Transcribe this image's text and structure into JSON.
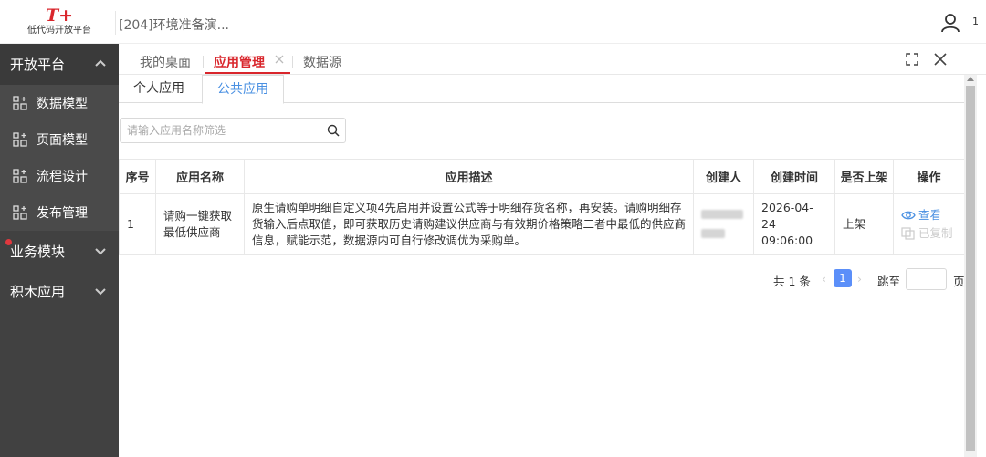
{
  "header": {
    "logo_mark": "T+",
    "logo_text": "低代码开放平台",
    "title": "[204]环境准备演...",
    "user_count": "1"
  },
  "sidebar": {
    "open_group": "开放平台",
    "items": [
      {
        "label": "数据模型"
      },
      {
        "label": "页面模型"
      },
      {
        "label": "流程设计"
      },
      {
        "label": "发布管理"
      }
    ],
    "business_group": "业务模块",
    "blocks_group": "积木应用"
  },
  "tabs": [
    {
      "label": "我的桌面"
    },
    {
      "label": "应用管理"
    },
    {
      "label": "数据源"
    }
  ],
  "subtabs": [
    {
      "label": "个人应用"
    },
    {
      "label": "公共应用"
    }
  ],
  "search": {
    "placeholder": "请输入应用名称筛选"
  },
  "table": {
    "headers": [
      "序号",
      "应用名称",
      "应用描述",
      "创建人",
      "创建时间",
      "是否上架",
      "操作"
    ],
    "rows": [
      {
        "index": "1",
        "name": "请购一键获取最低供应商",
        "description": "原生请购单明细自定义项4先启用并设置公式等于明细存货名称，再安装。请购明细存货输入后点取值，即可获取历史请购建议供应商与有效期价格策略二者中最低的供应商信息，赋能示范，数据源内可自行修改调优为采购单。",
        "creator": "1",
        "created_time": "2026-04-24 09:06:00",
        "listed": "上架",
        "op_view": "查看",
        "op_copied": "已复制"
      }
    ]
  },
  "pager": {
    "total": "共 1 条",
    "current_page": "1",
    "goto": "跳至",
    "unit": "页"
  },
  "colors": {
    "accent_red": "#d9262c",
    "accent_blue": "#4a90e2",
    "sidebar_bg": "#414141"
  }
}
